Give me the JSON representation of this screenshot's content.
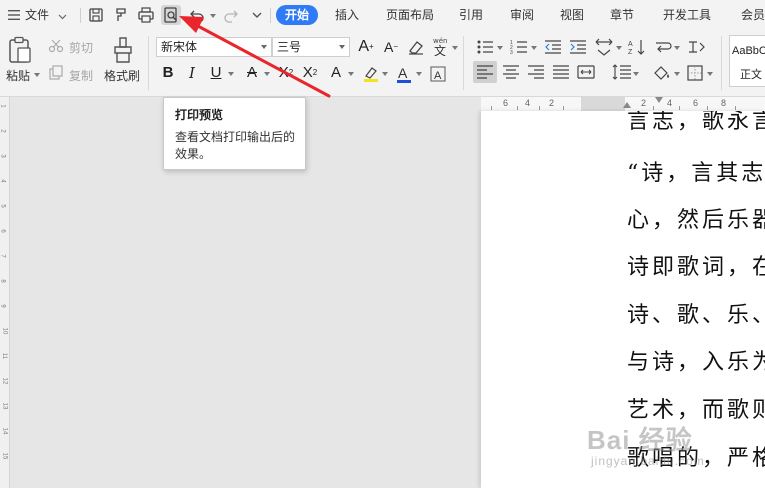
{
  "menubar": {
    "file_menu": "文件",
    "tabs": [
      {
        "label": "开始",
        "active": true
      },
      {
        "label": "插入",
        "active": false
      },
      {
        "label": "页面布局",
        "active": false
      },
      {
        "label": "引用",
        "active": false
      },
      {
        "label": "审阅",
        "active": false
      },
      {
        "label": "视图",
        "active": false
      },
      {
        "label": "章节",
        "active": false
      },
      {
        "label": "开发工具",
        "active": false
      },
      {
        "label": "会员",
        "active": false
      }
    ],
    "quick_access_icons": [
      "save-icon",
      "format-painter-icon",
      "print-icon",
      "print-preview-icon",
      "undo-icon",
      "redo-icon",
      "more-icon"
    ]
  },
  "ribbon": {
    "paste": "粘贴",
    "cut": "剪切",
    "copy": "复制",
    "format_painter": "格式刷",
    "font_name": "新宋体",
    "font_size": "三号",
    "style_preview": "AaBbC",
    "style_name": "正文"
  },
  "tooltip": {
    "title": "打印预览",
    "description": "查看文档打印输出后的效果。"
  },
  "document": {
    "lines": [
      "言志，歌永言",
      "“诗，言其志",
      "心，然后乐器",
      "诗即歌词，在",
      "诗、歌、乐、",
      "与诗，入乐为",
      "艺术，而歌则",
      "歌唱的，严格"
    ]
  },
  "ruler": {
    "horizontal_numbers": [
      "6",
      "4",
      "2",
      "2",
      "4",
      "6",
      "8"
    ],
    "vertical_numbers": [
      "1",
      "2",
      "3",
      "4",
      "5",
      "6",
      "7",
      "8",
      "9",
      "10",
      "11",
      "12",
      "13",
      "14",
      "15"
    ]
  },
  "watermark": {
    "main": "Bai 经验",
    "sub": "jingyan.baidu.com"
  },
  "colors": {
    "accent": "#2f7bf5",
    "annotation_arrow": "#e8262b",
    "font_color_bar": "#d62a2a",
    "highlight_bar": "#f5e21b",
    "font_color_blue": "#1e4fd6"
  }
}
